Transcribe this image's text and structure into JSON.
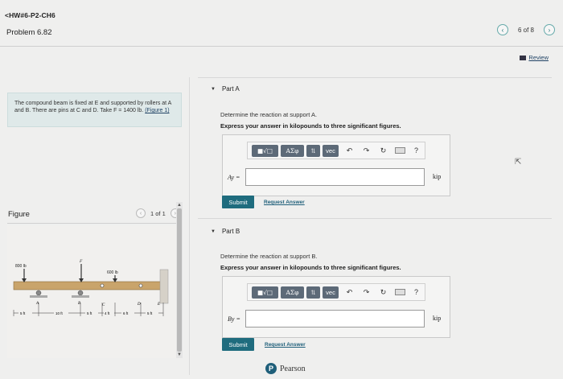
{
  "header": {
    "back_label": "<HW#6-P2-CH6",
    "problem_title": "Problem 6.82",
    "pager_text": "6 of 8",
    "review_label": "Review"
  },
  "intro": {
    "text": "The compound beam is fixed at E and supported by rollers at A and B. There are pins at C and D. Take F = 1400 lb.",
    "figure_link": "(Figure 1)"
  },
  "figure": {
    "label": "Figure",
    "pager_text": "1 of 1",
    "diagram": {
      "force_left": "800 lb",
      "force_F": "F",
      "force_right": "600 lb",
      "points": [
        "A",
        "B",
        "C",
        "D",
        "E"
      ],
      "dimensions": [
        "5 ft",
        "10 ft",
        "5 ft",
        "4 ft",
        "6 ft",
        "5 ft"
      ]
    }
  },
  "part_a": {
    "title": "Part A",
    "question": "Determine the reaction at support A.",
    "instruction": "Express your answer in kilopounds to three significant figures.",
    "answer_label": "Ay =",
    "answer_value": "",
    "unit": "kip",
    "submit_label": "Submit",
    "request_label": "Request Answer"
  },
  "part_b": {
    "title": "Part B",
    "question": "Determine the reaction at support B.",
    "instruction": "Express your answer in kilopounds to three significant figures.",
    "answer_label": "By =",
    "answer_value": "",
    "unit": "kip",
    "submit_label": "Submit",
    "request_label": "Request Answer"
  },
  "toolbar": {
    "template_btn": "■√□",
    "greek_btn": "ΑΣφ",
    "arrows_btn": "⇅",
    "vec_btn": "vec",
    "undo_icon": "↶",
    "redo_icon": "↷",
    "reset_icon": "↻",
    "help_icon": "?"
  },
  "footer": {
    "brand": "Pearson",
    "logo_letter": "P"
  }
}
